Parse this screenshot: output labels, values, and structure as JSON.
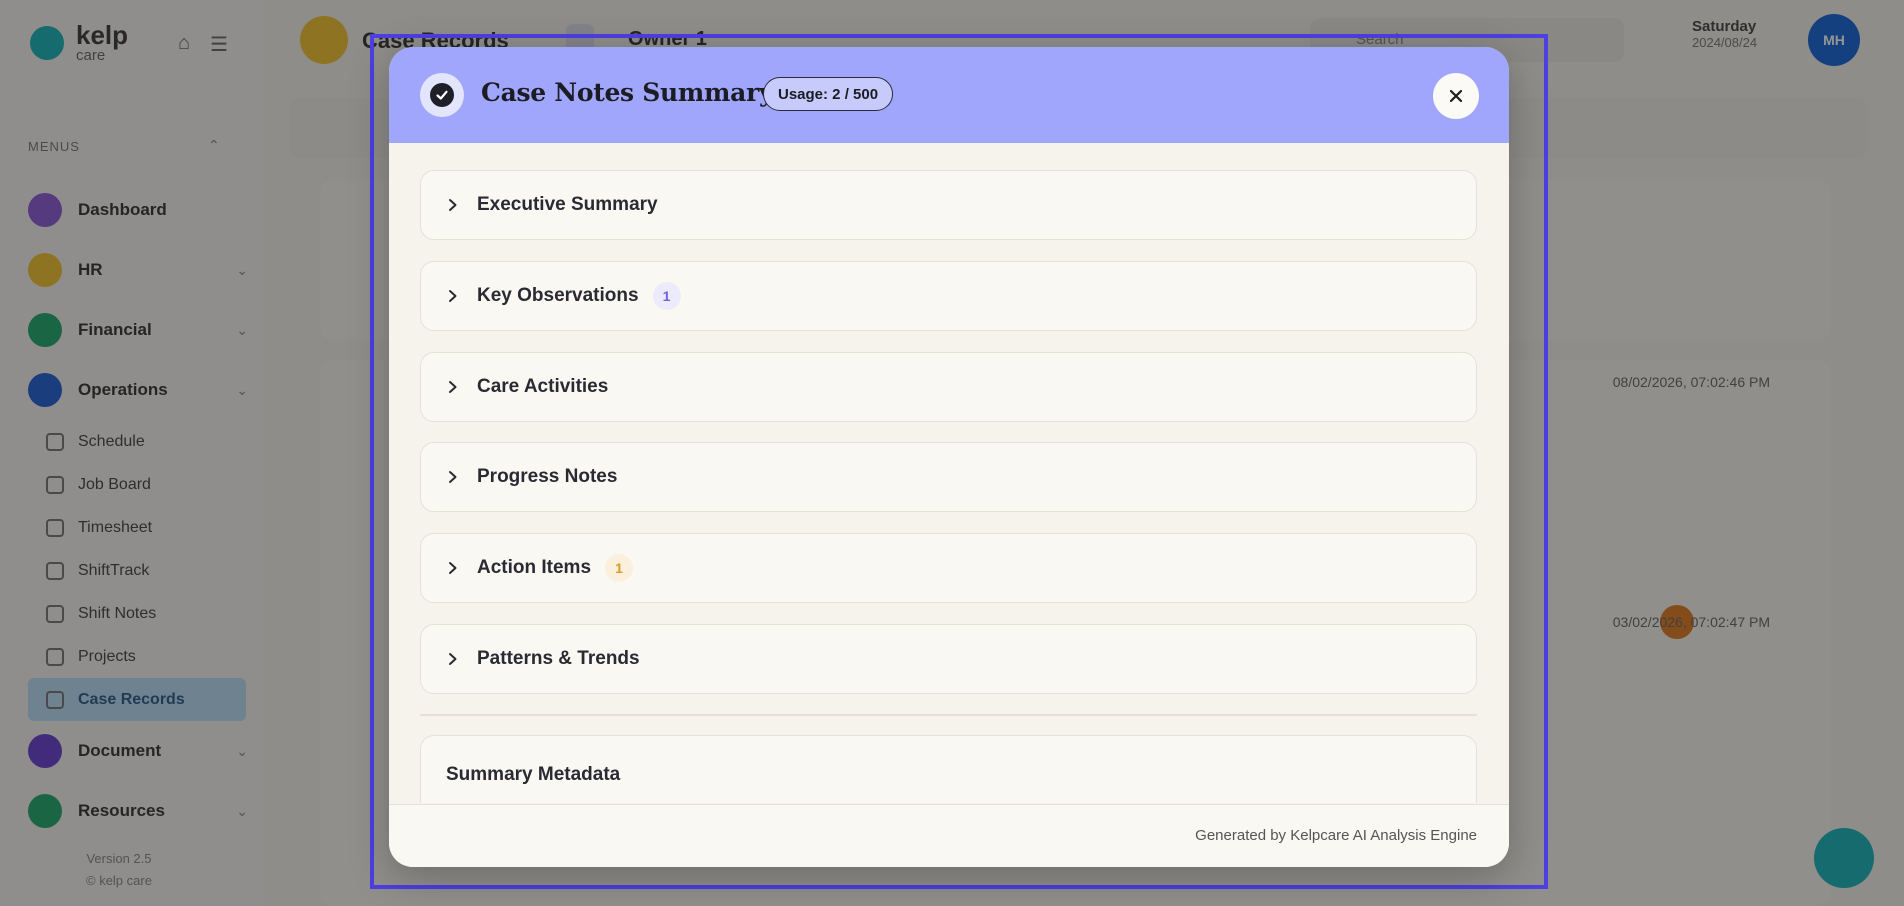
{
  "background": {
    "logo": {
      "line1": "kelp",
      "line2": "care"
    },
    "menu_label": "MENUS",
    "nav": [
      {
        "label": "Dashboard",
        "color": "#8a5cd6",
        "chevron": false
      },
      {
        "label": "HR",
        "color": "#f2c230",
        "chevron": true
      },
      {
        "label": "Financial",
        "color": "#1fa86a",
        "chevron": true
      },
      {
        "label": "Operations",
        "color": "#1f5fd6",
        "chevron": true
      }
    ],
    "sub_items": [
      "Schedule",
      "Job Board",
      "Timesheet",
      "ShiftTrack",
      "Shift Notes",
      "Projects",
      "Case Records"
    ],
    "nav_after": [
      {
        "label": "Document",
        "color": "#6a3fd1"
      },
      {
        "label": "Resources",
        "color": "#1fa86a"
      }
    ],
    "version": {
      "line1": "Version 2.5",
      "line2": "© kelp care"
    },
    "crumb_title": "Case Records",
    "crumb_sub": "Owner 1",
    "search_placeholder": "Search",
    "date": {
      "day": "Saturday",
      "date": "2024/08/24"
    },
    "avatar_initials": "MH",
    "records": [
      {
        "timestamp": "08/02/2026, 07:02:46 PM"
      },
      {
        "timestamp": "03/02/2026, 07:02:47 PM"
      }
    ]
  },
  "modal": {
    "title": "Case Notes Summary",
    "usage": "Usage: 2 / 500",
    "close_label": "×",
    "sections": [
      {
        "label": "Executive Summary",
        "badge": null
      },
      {
        "label": "Key Observations",
        "badge": "1",
        "badge_bg": "#ecebfb",
        "badge_fg": "#6b63d9"
      },
      {
        "label": "Care Activities",
        "badge": null
      },
      {
        "label": "Progress Notes",
        "badge": null
      },
      {
        "label": "Action Items",
        "badge": "1",
        "badge_bg": "#fbf0dc",
        "badge_fg": "#d99a2b"
      },
      {
        "label": "Patterns & Trends",
        "badge": null
      }
    ],
    "metadata_title": "Summary Metadata",
    "footer": "Generated by Kelpcare AI Analysis Engine"
  },
  "colors": {
    "header_bg": "#a0a6fb",
    "usage_pill_bg": "#c7cbfc",
    "focus_frame": "#4d3fe0"
  }
}
